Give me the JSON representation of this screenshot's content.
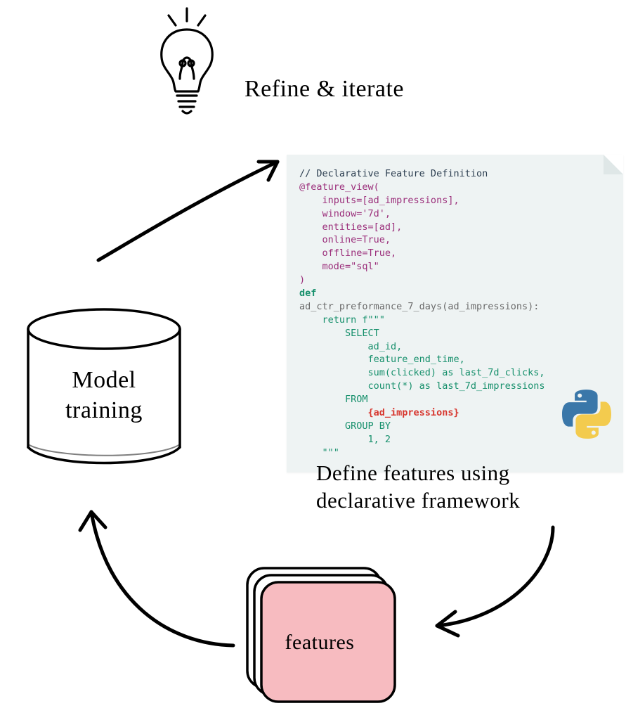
{
  "labels": {
    "refine": "Refine & iterate",
    "model_training": "Model\ntraining",
    "define_features": "Define features using\ndeclarative framework",
    "features": "features"
  },
  "code": {
    "comment": "// Declarative Feature Definition",
    "decorator_open": "@feature_view(",
    "arg_inputs": "    inputs=[ad_impressions],",
    "arg_window": "    window='7d',",
    "arg_entities": "    entities=[ad],",
    "arg_online": "    online=True,",
    "arg_offline": "    offline=True,",
    "arg_mode": "    mode=\"sql\"",
    "decorator_close": ")",
    "def": "def",
    "funcname": "ad_ctr_preformance_7_days(ad_impressions):",
    "return_open": "    return f\"\"\"",
    "sql_select": "        SELECT",
    "sql_col1": "            ad_id,",
    "sql_col2": "            feature_end_time,",
    "sql_col3": "            sum(clicked) as last_7d_clicks,",
    "sql_col4": "            count(*) as last_7d_impressions",
    "sql_from": "        FROM",
    "sql_from_tbl": "            {ad_impressions}",
    "sql_groupby": "        GROUP BY",
    "sql_groupby_cols": "            1, 2",
    "return_close": "    \"\"\""
  },
  "icons": {
    "lightbulb": "lightbulb-icon",
    "python": "python-icon"
  },
  "colors": {
    "features_fill": "#f7bbc0",
    "code_bg": "#eef3f3",
    "python_blue": "#3a77a9",
    "python_yellow": "#f3cb4e"
  }
}
